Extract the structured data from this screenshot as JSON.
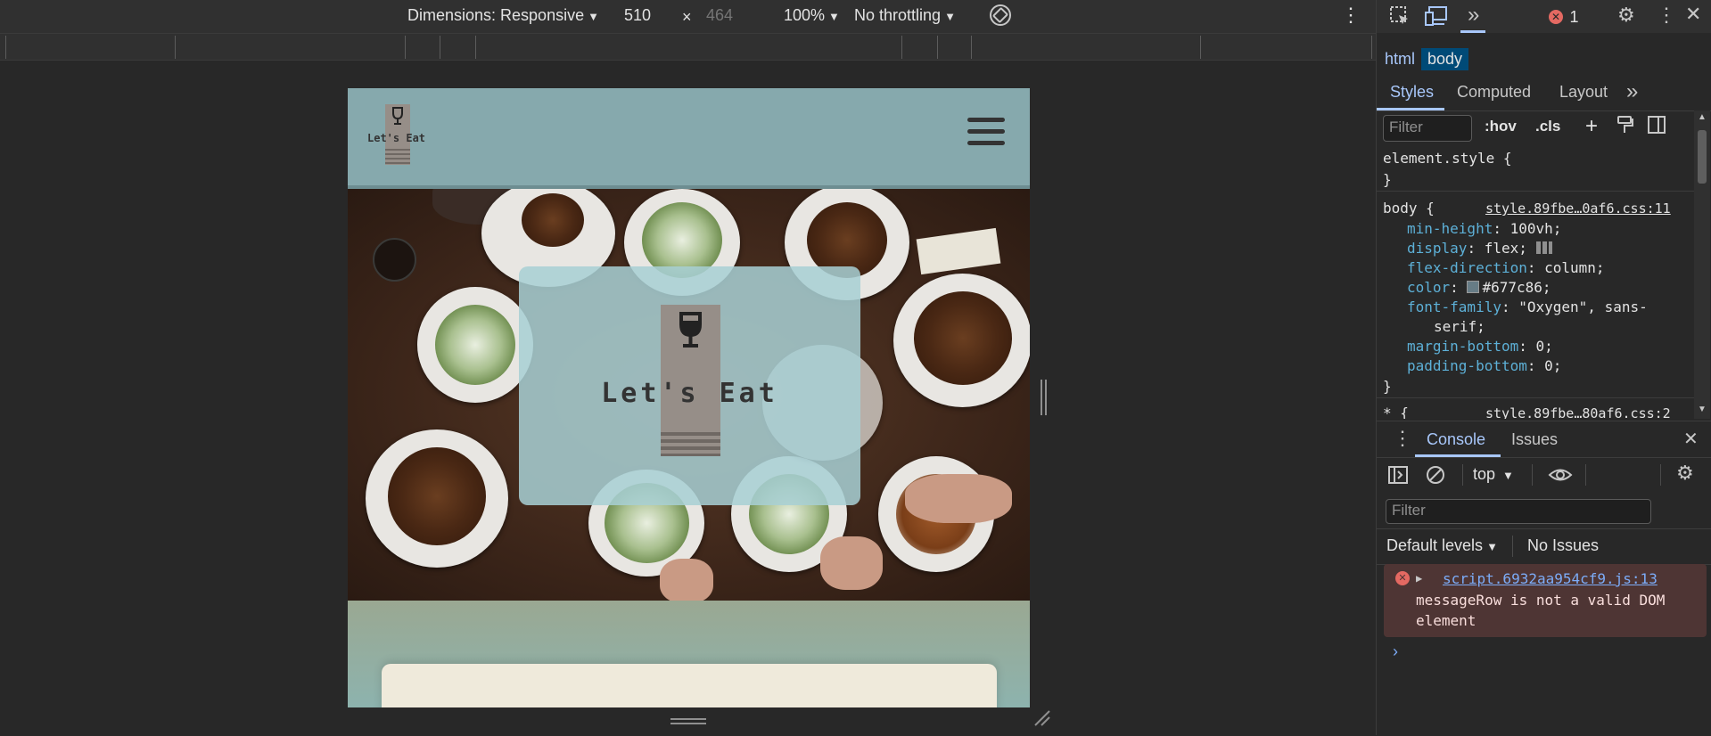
{
  "device_toolbar": {
    "dimensions_label": "Dimensions: Responsive",
    "width_value": "510",
    "times_symbol": "×",
    "height_value": "464",
    "zoom_label": "100%",
    "throttling_label": "No throttling"
  },
  "page": {
    "header_logo_text": "Let's Eat",
    "hero_logo_text": "Let's Eat"
  },
  "devtools": {
    "error_count": "1",
    "breadcrumbs": [
      "html",
      "body"
    ],
    "style_tabs": [
      "Styles",
      "Computed",
      "Layout"
    ],
    "styles_filter_placeholder": "Filter",
    "hov_label": ":hov",
    "cls_label": ".cls",
    "rules": {
      "element_style_open": "element.style {",
      "element_style_close": "}",
      "body_selector": "body {",
      "body_source": "style.89fbe…0af6.css:11",
      "declarations": [
        {
          "prop": "min-height",
          "value": "100vh;"
        },
        {
          "prop": "display",
          "value": "flex;"
        },
        {
          "prop": "flex-direction",
          "value": "column;"
        },
        {
          "prop": "color",
          "value": "#677c86;"
        },
        {
          "prop": "font-family",
          "value": "\"Oxygen\", sans-"
        },
        {
          "prop": "",
          "value": "serif;"
        },
        {
          "prop": "margin-bottom",
          "value": "0;"
        },
        {
          "prop": "padding-bottom",
          "value": "0;"
        }
      ],
      "body_close": "}",
      "star_selector": "* {",
      "star_source": "style.89fbe…80af6.css:2"
    },
    "drawer_tabs": [
      "Console",
      "Issues"
    ],
    "context_label": "top",
    "console_filter_placeholder": "Filter",
    "default_levels_label": "Default levels",
    "no_issues_label": "No Issues",
    "error": {
      "source": "script.6932aa954cf9.js:13",
      "message_line1": "messageRow is not a valid DOM",
      "message_line2": "element"
    },
    "prompt_symbol": "›"
  },
  "colors": {
    "page_header_bg": "#86a9ad",
    "hero_card_bg": "#a8cfd4",
    "logo_bg": "#968e88",
    "content_card_bg": "#efeadb",
    "accent_blue": "#a8c7fa",
    "error_bg": "#4e3534",
    "body_color_swatch": "#677c86"
  }
}
